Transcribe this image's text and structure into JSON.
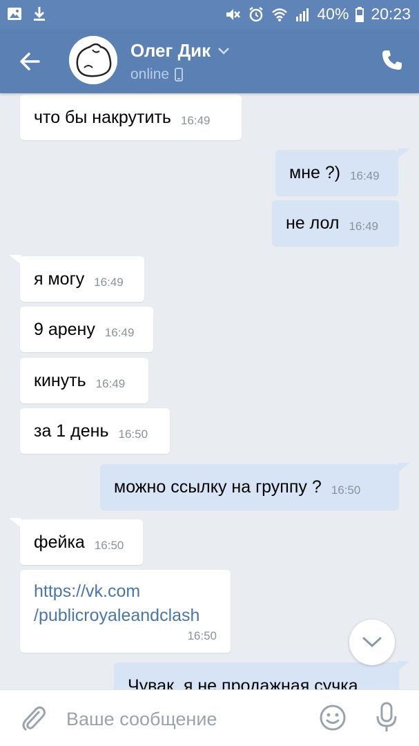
{
  "status_bar": {
    "battery": "40%",
    "time": "20:23",
    "left_icons": [
      "image-icon",
      "download-icon"
    ],
    "right_icons": [
      "mute-icon",
      "alarm-icon",
      "wifi-icon",
      "signal-icon",
      "battery-icon"
    ]
  },
  "header": {
    "name": "Олег Дик",
    "status": "online",
    "icons": [
      "back-arrow-icon",
      "chevron-down-icon",
      "mobile-icon",
      "phone-icon"
    ]
  },
  "messages": [
    {
      "dir": "in",
      "text": "что бы накрутить",
      "time": "16:49"
    },
    {
      "dir": "out",
      "text": "мне ?)",
      "time": "16:49"
    },
    {
      "dir": "out",
      "text": "не лол",
      "time": "16:49"
    },
    {
      "dir": "in",
      "text": "я могу",
      "time": "16:49"
    },
    {
      "dir": "in",
      "text": "9 арену",
      "time": "16:49"
    },
    {
      "dir": "in",
      "text": "кинуть",
      "time": "16:49"
    },
    {
      "dir": "in",
      "text": "за 1 день",
      "time": "16:50"
    },
    {
      "dir": "out",
      "text": "можно ссылку на группу ?",
      "time": "16:50"
    },
    {
      "dir": "in",
      "text": "фейка",
      "time": "16:50"
    },
    {
      "dir": "in",
      "link_line1": "https://vk.com",
      "link_line2": "/publicroyaleandclash",
      "time": "16:50"
    },
    {
      "dir": "out",
      "text": "Чувак, я не продажная сучка",
      "time": ""
    }
  ],
  "input": {
    "placeholder": "Ваше сообщение"
  },
  "colors": {
    "header": "#5a80b4",
    "status_bar": "#5f84b8",
    "background": "#e9edf2",
    "incoming_bubble": "#ffffff",
    "outgoing_bubble": "#d6e4f5",
    "link": "#4a77a8"
  }
}
